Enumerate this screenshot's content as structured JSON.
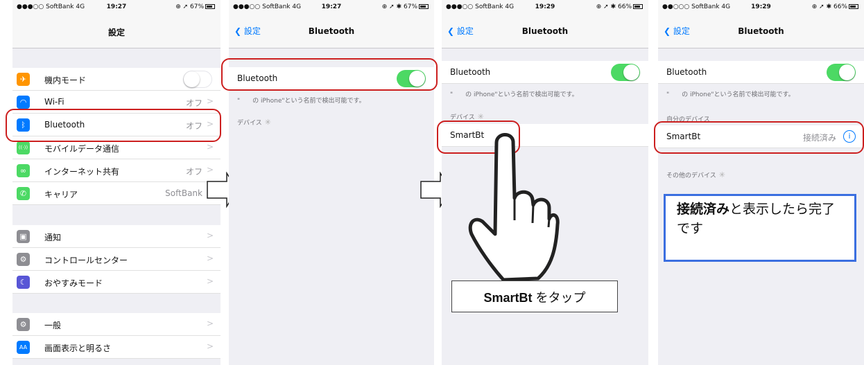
{
  "screens": [
    {
      "status": {
        "carrier": "●●●○○ SoftBank 4G",
        "time": "19:27",
        "battery": "⊕ ➚ 67%"
      },
      "nav_title": "設定",
      "cells": [
        {
          "label": "機内モード",
          "icon": "airplane-icon",
          "icon_glyph": "✈",
          "color": "#ff9500",
          "toggle": "off"
        },
        {
          "label": "Wi-Fi",
          "icon": "wifi-icon",
          "icon_glyph": "◠",
          "color": "#007aff",
          "value": "オフ"
        },
        {
          "label": "Bluetooth",
          "icon": "bluetooth-icon",
          "icon_glyph": "ᛒ",
          "color": "#007aff",
          "value": "オフ"
        },
        {
          "label": "モバイルデータ通信",
          "icon": "antenna-icon",
          "icon_glyph": "((·))",
          "color": "#4cd964",
          "value": ""
        },
        {
          "label": "インターネット共有",
          "icon": "link-icon",
          "icon_glyph": "∞",
          "color": "#4cd964",
          "value": "オフ"
        },
        {
          "label": "キャリア",
          "icon": "phone-icon",
          "icon_glyph": "✆",
          "color": "#4cd964",
          "value": "SoftBank"
        },
        {
          "label": "通知",
          "icon": "notification-icon",
          "icon_glyph": "▣",
          "color": "#8e8e93",
          "value": ""
        },
        {
          "label": "コントロールセンター",
          "icon": "control-center-icon",
          "icon_glyph": "⚙",
          "color": "#8e8e93",
          "value": ""
        },
        {
          "label": "おやすみモード",
          "icon": "moon-icon",
          "icon_glyph": "☾",
          "color": "#5856d6",
          "value": ""
        },
        {
          "label": "一般",
          "icon": "gear-icon",
          "icon_glyph": "⚙",
          "color": "#8e8e93",
          "value": ""
        },
        {
          "label": "画面表示と明るさ",
          "icon": "display-icon",
          "icon_glyph": "AA",
          "color": "#007aff",
          "value": ""
        }
      ]
    },
    {
      "status": {
        "carrier": "●●●○○ SoftBank 4G",
        "time": "19:27",
        "battery": "⊕ ➚ ✱ 67%"
      },
      "back": "設定",
      "nav_title": "Bluetooth",
      "bt_label": "Bluetooth",
      "note": "\"　　の iPhone\"という名前で検出可能です。",
      "devices_header": "デバイス"
    },
    {
      "status": {
        "carrier": "●●●○○ SoftBank 4G",
        "time": "19:29",
        "battery": "⊕ ➚ ✱ 66%"
      },
      "back": "設定",
      "nav_title": "Bluetooth",
      "bt_label": "Bluetooth",
      "note": "\"　　の iPhone\"という名前で検出可能です。",
      "devices_header": "デバイス",
      "device": "SmartBt",
      "callout": {
        "bold": "SmartBt",
        "text": " をタップ"
      }
    },
    {
      "status": {
        "carrier": "●●○○○ SoftBank 4G",
        "time": "19:29",
        "battery": "⊕ ➚ ✱ 66%"
      },
      "back": "設定",
      "nav_title": "Bluetooth",
      "bt_label": "Bluetooth",
      "note": "\"　　の iPhone\"という名前で検出可能です。",
      "my_devices_header": "自分のデバイス",
      "device": "SmartBt",
      "device_status": "接続済み",
      "other_header": "その他のデバイス",
      "message": {
        "bold": "接続済み",
        "text": "と表示したら完了です"
      }
    }
  ],
  "colors": {
    "ios_blue": "#007aff",
    "switch_on": "#4cd964",
    "highlight_red": "#cc1f1f",
    "message_border": "#3b6fe0"
  }
}
